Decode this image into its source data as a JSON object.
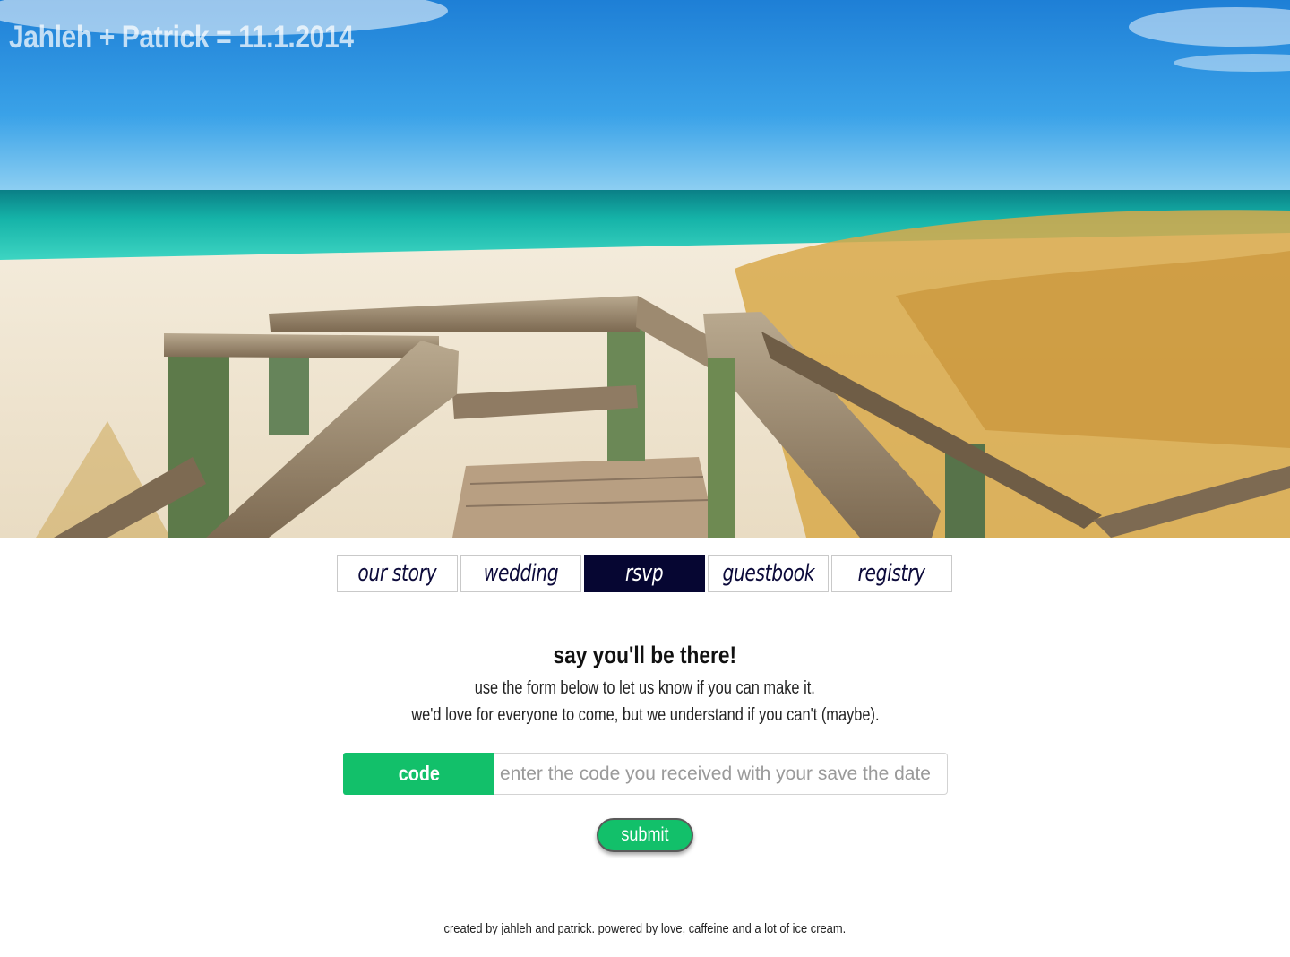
{
  "site": {
    "title": "Jahleh + Patrick = 11.1.2014"
  },
  "nav": {
    "tabs": [
      {
        "label": "our story",
        "active": false
      },
      {
        "label": "wedding",
        "active": false
      },
      {
        "label": "rsvp",
        "active": true
      },
      {
        "label": "guestbook",
        "active": false
      },
      {
        "label": "registry",
        "active": false
      }
    ]
  },
  "rsvp": {
    "heading": "say you'll be there!",
    "line1": "use the form below to let us know if you can make it.",
    "line2": "we'd love for everyone to come, but we understand if you can't (maybe).",
    "code_label": "code",
    "code_placeholder": "enter the code you received with your save the date",
    "submit_label": "submit"
  },
  "footer": {
    "text": "created by jahleh and patrick. powered by love, caffeine and a lot of ice cream."
  },
  "colors": {
    "accent_green": "#12c06a",
    "nav_active": "#060632",
    "nav_text": "#0c0a3a"
  },
  "hero": {
    "image_description_icon": "beach-boardwalk-photo"
  }
}
